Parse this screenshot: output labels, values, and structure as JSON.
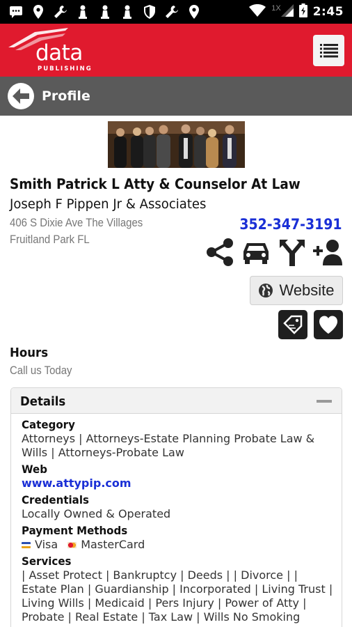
{
  "status_bar": {
    "time": "2:45",
    "network": "1X",
    "icons": [
      "message-icon",
      "location-icon",
      "wrench-icon",
      "chess-icon",
      "chess-icon",
      "chess-icon",
      "shield-icon",
      "wrench-icon",
      "location-icon",
      "wifi-icon",
      "signal-icon",
      "battery-icon"
    ]
  },
  "header": {
    "logo_word": "data",
    "logo_sub": "PUBLISHING",
    "menu_icon": "hamburger-icon",
    "brand_color": "#e01a2e"
  },
  "profile_bar": {
    "title": "Profile",
    "back_icon": "back-arrow-icon"
  },
  "listing": {
    "name": "Smith Patrick L Atty & Counselor At Law",
    "subtitle": "Joseph F Pippen Jr & Associates",
    "address_line1": "406 S Dixie Ave The Villages",
    "address_line2": "Fruitland Park FL",
    "phone": "352-347-3191",
    "actions": [
      "share-icon",
      "car-icon",
      "directions-icon",
      "add-contact-icon"
    ],
    "website_label": "Website",
    "tag_icon": "tag-icon",
    "heart_icon": "heart-icon"
  },
  "hours": {
    "label": "Hours",
    "value": "Call us Today"
  },
  "details": {
    "title": "Details",
    "category_label": "Category",
    "category_value": "Attorneys | Attorneys-Estate Planning Probate Law & Wills | Attorneys-Probate Law",
    "web_label": "Web",
    "web_value": "www.attypip.com",
    "credentials_label": "Credentials",
    "credentials_value": "Locally Owned & Operated",
    "payment_label": "Payment Methods",
    "payment_visa": "Visa",
    "payment_mc": "MasterCard",
    "services_label": "Services",
    "services_value": "| Asset Protect | Bankruptcy | Deeds | | Divorce | | Estate Plan | Guardianship | Incorporated | Living Trust | Living Wills | Medicaid | Pers Injury | Power of Atty | Probate | Real Estate | Tax Law | Wills No Smoking"
  }
}
